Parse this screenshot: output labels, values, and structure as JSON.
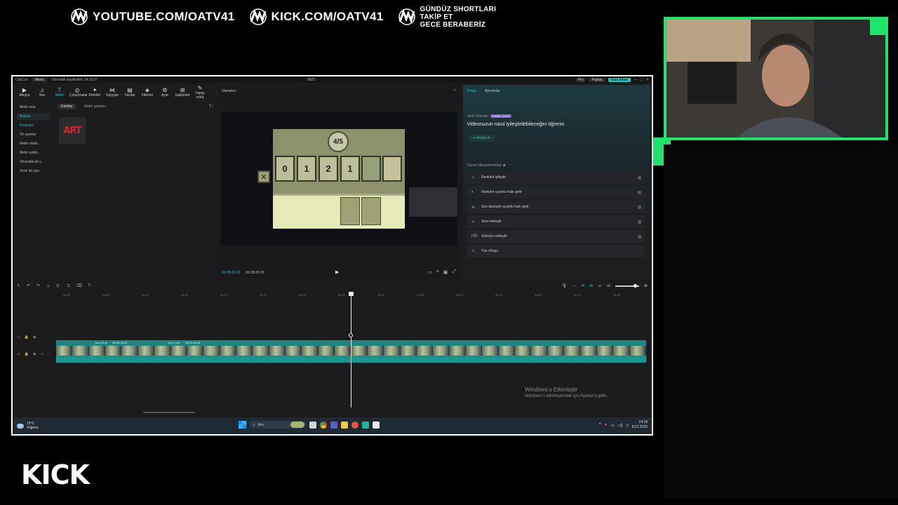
{
  "overlay": {
    "banner": [
      {
        "icon": "ataturk-signature-icon",
        "text": "YOUTUBE.COM/OATV41"
      },
      {
        "icon": "ataturk-signature-icon",
        "text": "KICK.COM/OATV41"
      }
    ],
    "note_lines": [
      "GÜNDÜZ SHORTLARI",
      "TAKİP ET",
      "GECE BERABERİZ"
    ],
    "kick_logo": "KICK",
    "accent": "#1fe36b"
  },
  "app": {
    "titlebar": {
      "app_name": "CapCut",
      "menu": "Menü",
      "autosave": "Otomatik kaydedildi: 14:18:37",
      "project": "0823",
      "pro": "Pro",
      "share": "Paylaş",
      "export": "Dışa Aktar"
    },
    "toolbar": [
      {
        "icon": "media-icon",
        "glyph": "▶",
        "label": "Medya"
      },
      {
        "icon": "audio-icon",
        "glyph": "♫",
        "label": "Ses"
      },
      {
        "icon": "text-icon",
        "glyph": "T",
        "label": "Metin"
      },
      {
        "icon": "sticker-icon",
        "glyph": "◎",
        "label": "Çıkartmalar"
      },
      {
        "icon": "effects-icon",
        "glyph": "✦",
        "label": "Efektler"
      },
      {
        "icon": "transitions-icon",
        "glyph": "⋈",
        "label": "Geçişler"
      },
      {
        "icon": "captions-icon",
        "glyph": "▤",
        "label": "Yazılar"
      },
      {
        "icon": "filters-icon",
        "glyph": "◈",
        "label": "Filtreler"
      },
      {
        "icon": "adjust-icon",
        "glyph": "⚙",
        "label": "Ayar"
      },
      {
        "icon": "templates-icon",
        "glyph": "⊞",
        "label": "Şablonlar"
      },
      {
        "icon": "ai-icon",
        "glyph": "✎",
        "label": "Yapay zekâ"
      }
    ],
    "left_panel": [
      "Metin ekle",
      "Bulunu",
      "Favoriler",
      "Ön ayarlar",
      "Metin efekti...",
      "Metin şablo...",
      "Otomatik alt y...",
      "Yerel alt yazı"
    ],
    "media_panel": {
      "tabs": [
        "Efektler",
        "Metin şablonu"
      ],
      "sort": "T↕",
      "thumb_text": "ART"
    },
    "player": {
      "title": "Oynatıcı",
      "counter": "4/5",
      "cards": [
        "0",
        "1",
        "2",
        "1"
      ],
      "current_time": "00:05:33:21",
      "total_time": "00:28:20:25"
    },
    "right_panel": {
      "tabs": [
        "Proje",
        "Ayrıntılar"
      ],
      "smart_label": "Akıllı Öneriler",
      "smart_badge": "SINIRLI SÜRE",
      "smart_title": "Videonuzun nasıl iyileştirilebileceğini öğrenin",
      "analyze": "Analiz et",
      "general_title": "Genel düzenlemeler",
      "options": [
        {
          "icon": "magic-wand-icon",
          "glyph": "✧",
          "label": "Renkleri iyileştir"
        },
        {
          "icon": "color-match-icon",
          "glyph": "◐",
          "label": "Renkleri uyumlu hale getir"
        },
        {
          "icon": "audio-level-icon",
          "glyph": "≋",
          "label": "Ses düzeyini uyumlu hale getir"
        },
        {
          "icon": "audio-clean-icon",
          "glyph": "✧",
          "label": "Sesi netleştir"
        },
        {
          "icon": "hd-icon",
          "glyph": "HD",
          "label": "Videoyu netleştir"
        },
        {
          "icon": "face-retouch-icon",
          "glyph": "☺",
          "label": "Yüz rötuşu"
        }
      ]
    },
    "timeline": {
      "ruler": [
        "04:20",
        "04:30",
        "04:40",
        "04:50",
        "05:00",
        "05:10",
        "05:20",
        "05:30",
        "05:40",
        "05:50",
        "06:00",
        "06:10",
        "06:20",
        "06:30",
        "06:40",
        "06:50"
      ],
      "clips": [
        {
          "label": "Ins 2-3.ts",
          "time": "00:00:18:23"
        },
        {
          "label": "Ins 2-3.ts",
          "time": "00:23:24:09"
        }
      ],
      "frame_count": 36
    },
    "watermark": {
      "title": "Windows'u Etkinleştir",
      "sub": "Windows'u etkinleştirmek için Ayarlar'a gidin."
    },
    "taskbar": {
      "temp": "13°C",
      "weather": "Yağmur",
      "search": "Ara",
      "time": "14:18",
      "date": "8.01.2026"
    }
  }
}
